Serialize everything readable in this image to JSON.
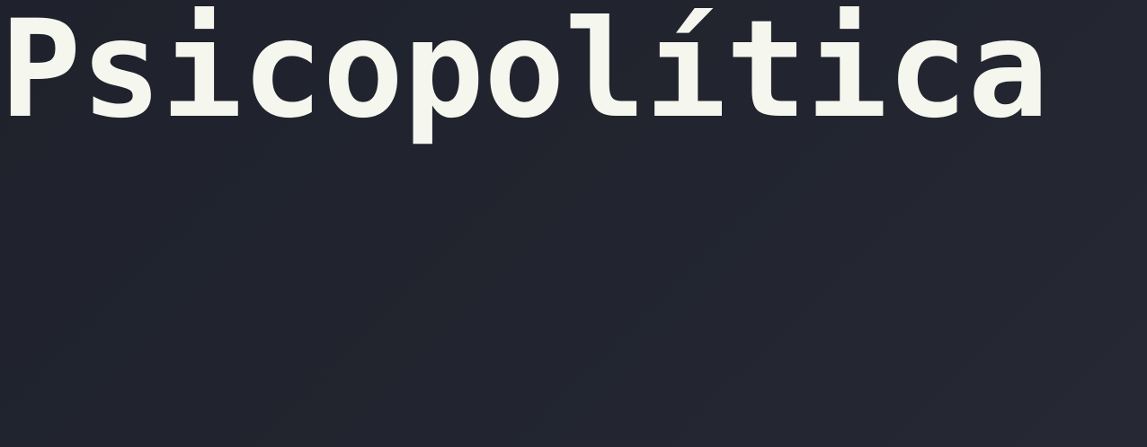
{
  "page": {
    "title": "Psicopolítica",
    "colors": {
      "background": "#22252f",
      "title_text": "#f5f7ef"
    }
  }
}
